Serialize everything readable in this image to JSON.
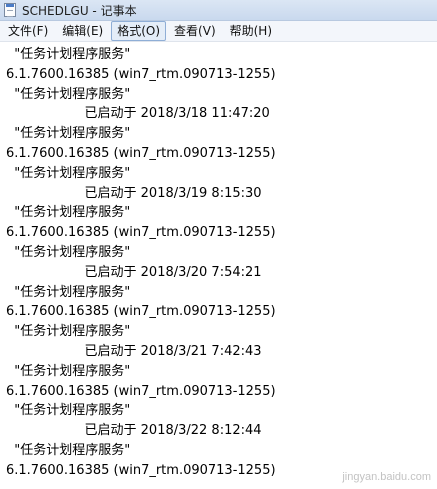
{
  "window": {
    "title": "SCHEDLGU - 记事本"
  },
  "menu": [
    {
      "label": "文件(F)"
    },
    {
      "label": "编辑(E)"
    },
    {
      "label": "格式(O)",
      "active": true
    },
    {
      "label": "查看(V)"
    },
    {
      "label": "帮助(H)"
    }
  ],
  "content": {
    "lines": [
      "  \"任务计划程序服务\"",
      "6.1.7600.16385 (win7_rtm.090713-1255)",
      "  \"任务计划程序服务\"",
      "                   已启动于 2018/3/18 11:47:20",
      "  \"任务计划程序服务\"",
      "6.1.7600.16385 (win7_rtm.090713-1255)",
      "  \"任务计划程序服务\"",
      "                   已启动于 2018/3/19 8:15:30",
      "  \"任务计划程序服务\"",
      "6.1.7600.16385 (win7_rtm.090713-1255)",
      "  \"任务计划程序服务\"",
      "                   已启动于 2018/3/20 7:54:21",
      "  \"任务计划程序服务\"",
      "6.1.7600.16385 (win7_rtm.090713-1255)",
      "  \"任务计划程序服务\"",
      "                   已启动于 2018/3/21 7:42:43",
      "  \"任务计划程序服务\"",
      "6.1.7600.16385 (win7_rtm.090713-1255)",
      "  \"任务计划程序服务\"",
      "                   已启动于 2018/3/22 8:12:44",
      "  \"任务计划程序服务\"",
      "6.1.7600.16385 (win7_rtm.090713-1255)"
    ]
  },
  "watermark": "jingyan.baidu.com"
}
